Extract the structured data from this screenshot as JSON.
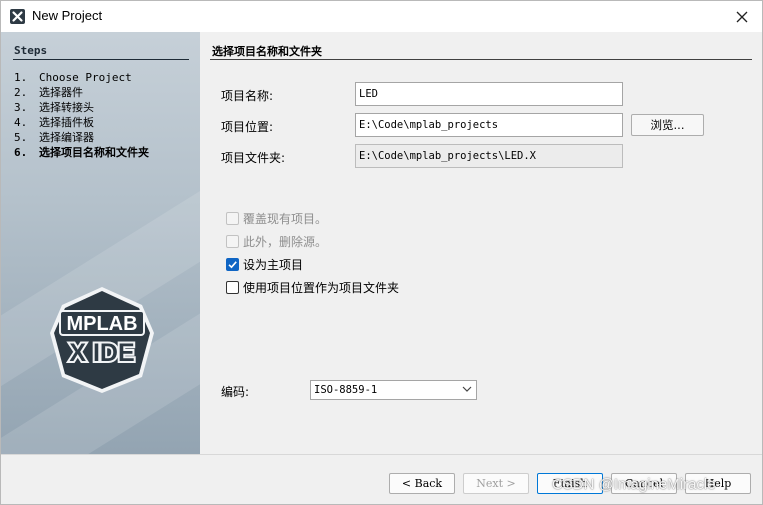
{
  "window": {
    "title": "New Project",
    "icon": "mplab-x-icon"
  },
  "sidebar": {
    "title": "Steps",
    "steps": [
      {
        "num": "1.",
        "label": "Choose Project"
      },
      {
        "num": "2.",
        "label": "选择器件"
      },
      {
        "num": "3.",
        "label": "选择转接头"
      },
      {
        "num": "4.",
        "label": "选择插件板"
      },
      {
        "num": "5.",
        "label": "选择编译器"
      },
      {
        "num": "6.",
        "label": "选择项目名称和文件夹"
      }
    ],
    "current_step": 6,
    "logo": {
      "line1": "MPLAB",
      "line2": "X IDE"
    }
  },
  "main": {
    "title": "选择项目名称和文件夹",
    "project_name": {
      "label": "项目名称:",
      "value": "LED"
    },
    "project_location": {
      "label": "项目位置:",
      "value": "E:\\Code\\mplab_projects",
      "browse_label": "浏览..."
    },
    "project_folder": {
      "label": "项目文件夹:",
      "value": "E:\\Code\\mplab_projects\\LED.X"
    },
    "options": [
      {
        "label": "覆盖现有项目。",
        "checked": false,
        "enabled": false
      },
      {
        "label": "此外，删除源。",
        "checked": false,
        "enabled": false
      },
      {
        "label": "设为主项目",
        "checked": true,
        "enabled": true
      },
      {
        "label": "使用项目位置作为项目文件夹",
        "checked": false,
        "enabled": true
      }
    ],
    "encoding": {
      "label": "编码:",
      "value": "ISO-8859-1"
    }
  },
  "footer": {
    "back": "< Back",
    "next": "Next >",
    "finish": "Finish",
    "cancel": "Cancel",
    "help": "Help",
    "watermark": "CSDN @ImagineMiracle"
  },
  "colors": {
    "accent": "#0f65c4",
    "sidebar_top": "#c6d0d8",
    "sidebar_bottom": "#93a4b2",
    "logo_dark": "#2e3a44"
  }
}
